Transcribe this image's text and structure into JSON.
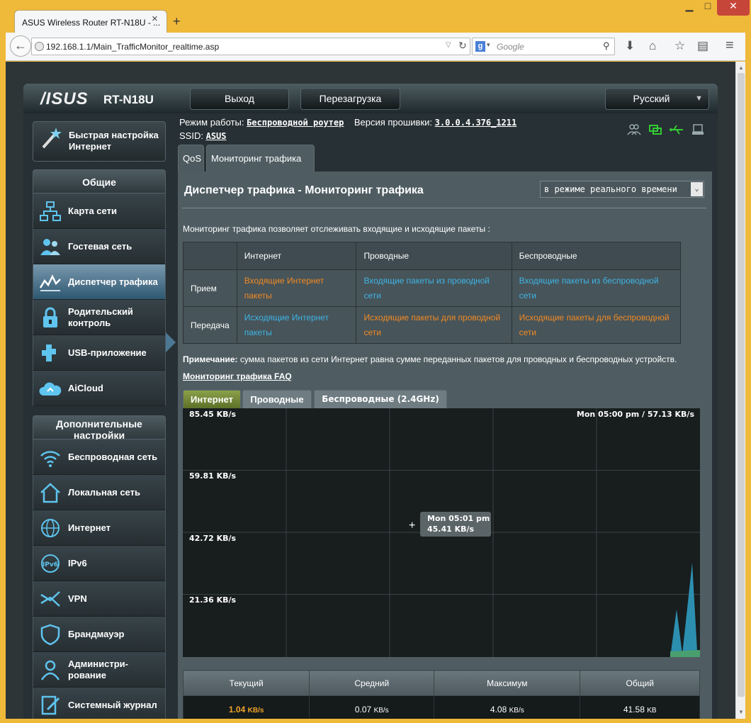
{
  "browser": {
    "tab_title": "ASUS Wireless Router RT-N18U - ...",
    "tab_close": "×",
    "new_tab": "+",
    "url": "192.168.1.1/Main_TrafficMonitor_realtime.asp",
    "search_placeholder": "Google"
  },
  "header": {
    "logo": "/ISUS",
    "model": "RT-N18U",
    "logout_label": "Выход",
    "reboot_label": "Перезагрузка",
    "language": "Русский"
  },
  "sidebar": {
    "quick_setup": "Быстрая настройка Интернет",
    "general_header": "Общие",
    "general_items": [
      {
        "label": "Карта сети",
        "icon": "network-map-icon"
      },
      {
        "label": "Гостевая сеть",
        "icon": "guest-network-icon"
      },
      {
        "label": "Диспетчер трафика",
        "icon": "traffic-manager-icon"
      },
      {
        "label": "Родительский контроль",
        "icon": "parental-control-icon"
      },
      {
        "label": "USB-приложение",
        "icon": "usb-app-icon"
      },
      {
        "label": "AiCloud",
        "icon": "cloud-icon"
      }
    ],
    "advanced_header": "Дополнительные настройки",
    "advanced_items": [
      {
        "label": "Беспроводная сеть",
        "icon": "wireless-icon"
      },
      {
        "label": "Локальная сеть",
        "icon": "lan-home-icon"
      },
      {
        "label": "Интернет",
        "icon": "globe-icon"
      },
      {
        "label": "IPv6",
        "icon": "ipv6-icon"
      },
      {
        "label": "VPN",
        "icon": "vpn-icon"
      },
      {
        "label": "Брандмауэр",
        "icon": "firewall-shield-icon"
      },
      {
        "label": "Администри-рование",
        "icon": "admin-user-icon"
      },
      {
        "label": "Системный журнал",
        "icon": "system-log-icon"
      }
    ]
  },
  "status": {
    "mode_label": "Режим работы:",
    "mode_value": "Беспроводной роутер",
    "firmware_label": "Версия прошивки:",
    "firmware_value": "3.0.0.4.376_1211",
    "ssid_label": "SSID:",
    "ssid_value": "ASUS"
  },
  "tabs": {
    "qos": "QoS",
    "monitor": "Мониторинг трафика"
  },
  "content": {
    "title": "Диспетчер трафика - Мониторинг трафика",
    "mode_select": "в режиме реального времени",
    "intro": "Мониторинг трафика позволяет отслеживать входящие и исходящие пакеты :",
    "table_headers": [
      "",
      "Интернет",
      "Проводные",
      "Беспроводные"
    ],
    "rows": [
      {
        "label": "Прием",
        "internet": "Входящие Интернет пакеты",
        "wired": "Входящие пакеты из проводной сети",
        "wireless": "Входящие пакеты из беспроводной сети"
      },
      {
        "label": "Передача",
        "internet": "Исходящие Интернет пакеты",
        "wired": "Исходящие пакеты для проводной сети",
        "wireless": "Исходящие пакеты для беспроводной сети"
      }
    ],
    "note_label": "Примечание:",
    "note_text": " сумма пакетов из сети Интернет равна сумме переданных пакетов для проводных и беспроводных устройств.",
    "faq": "Мониторинг трафика FAQ",
    "graph_tabs": [
      "Интернет",
      "Проводные",
      "Беспроводные (2.4GHz)"
    ]
  },
  "graph": {
    "y_labels": [
      "85.45 KB/s",
      "59.81 KB/s",
      "42.72 KB/s",
      "21.36 KB/s"
    ],
    "readout": "Mon 05:00 pm / 57.13 KB/s",
    "tooltip_time": "Mon 05:01 pm",
    "tooltip_value": "45.41 KB/s",
    "crosshair": "+",
    "colors": {
      "area_blue": "#2c8fb0",
      "area_green": "#4a9f6e",
      "grid": "#3a4244"
    },
    "spike_levels": [
      0,
      0.48,
      0.03,
      0.95,
      0.06
    ]
  },
  "stats": {
    "headers": [
      "Текущий",
      "Средний",
      "Максимум",
      "Общий"
    ],
    "values": [
      "1.04",
      "0.07",
      "4.08",
      "41.58"
    ],
    "units": [
      "KB/s",
      "KB/s",
      "KB/s",
      "KB"
    ]
  }
}
